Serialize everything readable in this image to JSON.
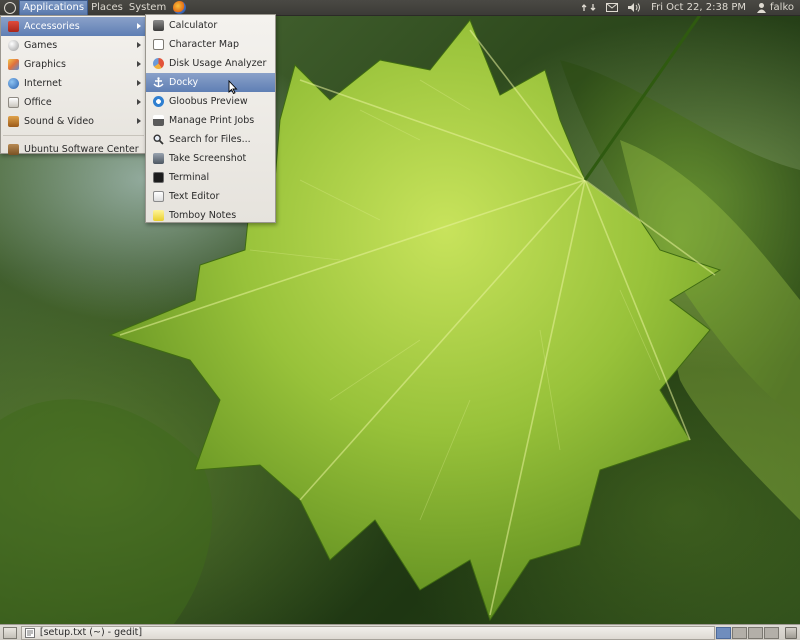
{
  "top_panel": {
    "menus": [
      "Applications",
      "Places",
      "System"
    ],
    "clock": "Fri Oct 22,  2:38 PM",
    "user": "falko",
    "icons": [
      "ubuntu-logo-icon",
      "firefox-icon",
      "network-icon",
      "mail-icon",
      "volume-icon",
      "user-icon"
    ]
  },
  "applications_menu": {
    "items": [
      {
        "label": "Accessories",
        "icon": "accessories-icon",
        "submenu": true,
        "selected": true
      },
      {
        "label": "Games",
        "icon": "games-icon",
        "submenu": true
      },
      {
        "label": "Graphics",
        "icon": "graphics-icon",
        "submenu": true
      },
      {
        "label": "Internet",
        "icon": "internet-icon",
        "submenu": true
      },
      {
        "label": "Office",
        "icon": "office-icon",
        "submenu": true
      },
      {
        "label": "Sound & Video",
        "icon": "sound-video-icon",
        "submenu": true
      },
      {
        "label": "Ubuntu Software Center",
        "icon": "software-center-icon",
        "submenu": false
      }
    ]
  },
  "accessories_menu": {
    "items": [
      {
        "label": "Calculator",
        "icon": "calculator-icon"
      },
      {
        "label": "Character Map",
        "icon": "character-map-icon"
      },
      {
        "label": "Disk Usage Analyzer",
        "icon": "disk-usage-icon"
      },
      {
        "label": "Docky",
        "icon": "docky-icon",
        "selected": true
      },
      {
        "label": "Gloobus Preview",
        "icon": "gloobus-icon"
      },
      {
        "label": "Manage Print Jobs",
        "icon": "printer-icon"
      },
      {
        "label": "Search for Files...",
        "icon": "search-icon"
      },
      {
        "label": "Take Screenshot",
        "icon": "screenshot-icon"
      },
      {
        "label": "Terminal",
        "icon": "terminal-icon"
      },
      {
        "label": "Text Editor",
        "icon": "text-editor-icon"
      },
      {
        "label": "Tomboy Notes",
        "icon": "tomboy-icon"
      }
    ]
  },
  "bottom_panel": {
    "task": "[setup.txt (~) - gedit]",
    "workspaces": 4,
    "active_workspace": 1
  },
  "colors": {
    "panel_dark": "#3c3b37",
    "menu_bg": "#f2f1ee",
    "selection": "#6e8cbe",
    "leaf_light": "#b8dc50",
    "leaf_dark": "#5c8a1c"
  }
}
